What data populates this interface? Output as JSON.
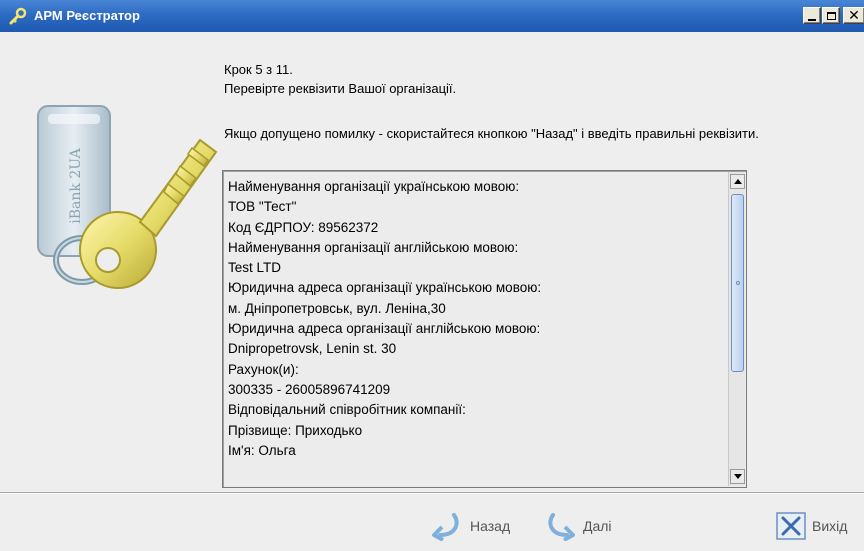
{
  "window": {
    "title": "АРМ Реєстратор"
  },
  "artwork": {
    "token_text": "iBank 2UA"
  },
  "step": {
    "line1": "Крок 5 з 11.",
    "line2": "Перевірте реквізити Вашої організації."
  },
  "hint": "Якщо допущено помилку - скористайтеся кнопкою \"Назад\" і введіть правильні реквізити.",
  "details": [
    "Найменування організації українською мовою:",
    "ТОВ \"Тест\"",
    "Код ЄДРПОУ: 89562372",
    "Найменування організації  англійською мовою:",
    "Test LTD",
    "Юридична адреса організації українською мовою:",
    "м. Дніпропетровськ, вул. Леніна,30",
    "Юридична адреса організації англійською мовою:",
    "Dnipropetrovsk, Lenin st. 30",
    "Рахунок(и):",
    "300335 - 26005896741209",
    "Відповідальний співробітник компанії:",
    "Прізвище: Приходько",
    "Ім'я: Ольга"
  ],
  "buttons": {
    "back": "Назад",
    "next": "Далі",
    "exit": "Вихід"
  },
  "colors": {
    "titlebar": "#2d6bc4",
    "key": "#e6dc6a",
    "thumb": "#b9cff0"
  }
}
